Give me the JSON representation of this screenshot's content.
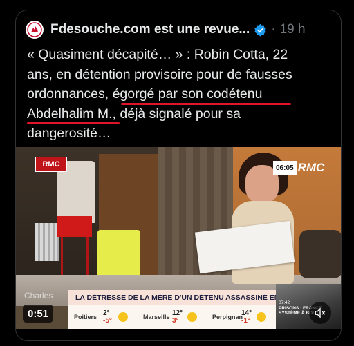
{
  "tweet": {
    "display_name": "Fdesouche.com est une revue...",
    "separator": "·",
    "timestamp": "19 h",
    "avatar_icon": "rooster-logo-icon",
    "verified_icon": "verified-badge-icon",
    "accent_color": "#1d9bf0",
    "lines": [
      "« Quasiment décapité… » : Robin Cotta, 22",
      "ans, en détention provisoire pour de fausses",
      "ordonnances, égorgé par son codétenu",
      "Abdelhalim M., déjà signalé pour sa",
      "dangerosité…"
    ]
  },
  "video": {
    "channel_logo_left": "RMC",
    "channel_logo_right": "RMC",
    "clock": "06:05",
    "ticker_headline": "LA DÉTRESSE DE LA MÈRE D'UN DÉTENU ASSASSINÉ EN PRISON",
    "weather": [
      {
        "city": "Poitiers",
        "high": "2°",
        "low": "-5°"
      },
      {
        "city": "Marseille",
        "high": "12°",
        "low": "3°"
      },
      {
        "city": "Perpignan",
        "high": "14°",
        "low": "-1°"
      }
    ],
    "side_thumb_time": "07:42",
    "side_thumb_text": "PRISONS : FRANCE SYSTÈME À BOUT",
    "watermark": "Charles",
    "duration": "0:51",
    "mute_icon": "speaker-muted-icon",
    "underline_color": "#e0142a"
  }
}
